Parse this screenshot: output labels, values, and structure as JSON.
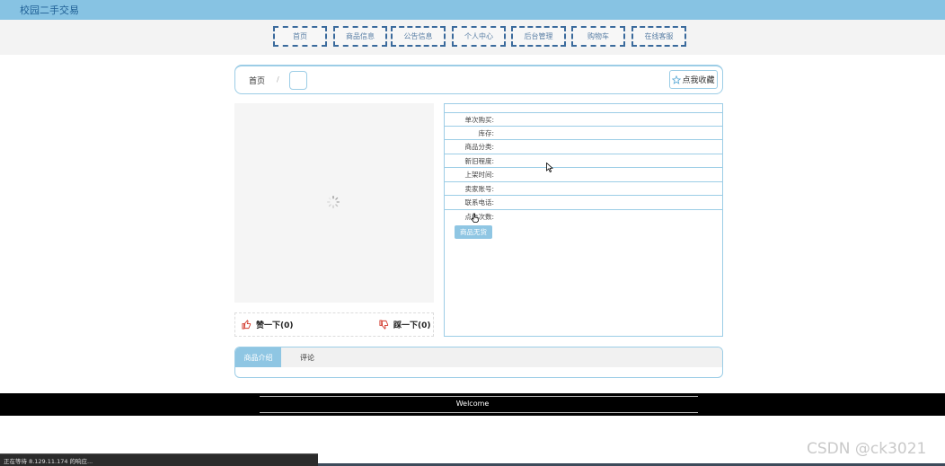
{
  "app": {
    "title": "校园二手交易"
  },
  "nav": {
    "items": [
      {
        "label": "首页"
      },
      {
        "label": "商品信息"
      },
      {
        "label": "公告信息"
      },
      {
        "label": "个人中心"
      },
      {
        "label": "后台管理"
      },
      {
        "label": "购物车"
      },
      {
        "label": "在线客服"
      }
    ]
  },
  "breadcrumb": {
    "home": "首页",
    "separator": "/"
  },
  "favorite": {
    "label": "点我收藏",
    "icon": "star-outline-icon"
  },
  "gallery": {
    "loading_icon": "spinner-icon"
  },
  "votes": {
    "like": {
      "label": "赞一下(0)",
      "icon": "thumbs-up-icon"
    },
    "dislike": {
      "label": "踩一下(0)",
      "icon": "thumbs-down-icon"
    }
  },
  "info": {
    "rows": [
      {
        "label": "单次购买:",
        "value": ""
      },
      {
        "label": "库存:",
        "value": ""
      },
      {
        "label": "商品分类:",
        "value": ""
      },
      {
        "label": "新旧程度:",
        "value": ""
      },
      {
        "label": "上架时间:",
        "value": ""
      },
      {
        "label": "卖家账号:",
        "value": ""
      },
      {
        "label": "联系电话:",
        "value": ""
      },
      {
        "label": "点击次数:",
        "value": ""
      }
    ],
    "soldout_label": "商品无货"
  },
  "tabs": [
    {
      "label": "商品介绍",
      "active": true
    },
    {
      "label": "评论",
      "active": false
    }
  ],
  "footer": {
    "text": "Welcome"
  },
  "statusbar": {
    "text": "正在等待 8.129.11.174 的响应..."
  },
  "watermark": {
    "text": "CSDN @ck3021"
  },
  "colors": {
    "header_bg": "#87c3e3",
    "accent": "#8fc6e3",
    "border": "#9ccde6",
    "nav_border": "#3a6a9c"
  }
}
